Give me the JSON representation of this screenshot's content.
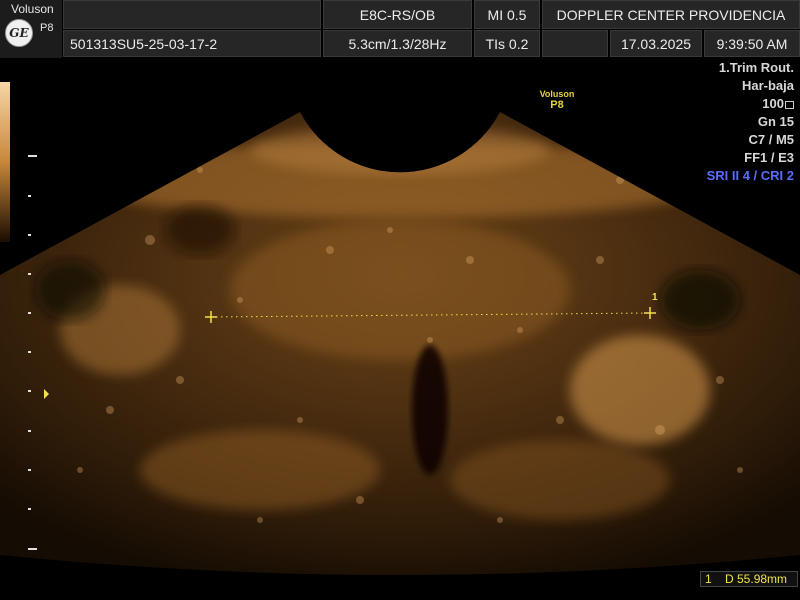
{
  "header": {
    "brand": "Voluson",
    "logo_text": "GE",
    "probe_small": "P8",
    "probe": "E8C-RS/OB",
    "mi": "MI  0.5",
    "center": "DOPPLER CENTER PROVIDENCIA",
    "patient_id": "501313SU5-25-03-17-2",
    "depth": "5.3cm/1.3/28Hz",
    "tis": "TIs  0.2",
    "date": "17.03.2025",
    "time": "9:39:50 AM"
  },
  "right_panel": {
    "preset": "1.Trim Rout.",
    "harmonic": "Har-baja",
    "power": "100",
    "gain": "Gn  15",
    "compression": "C7 / M5",
    "filter": "FF1 / E3",
    "sri": "SRI II 4 / CRI 2"
  },
  "image_label": {
    "brand": "Voluson",
    "probe": "P8"
  },
  "caliper": {
    "label": "1"
  },
  "measurement": {
    "text": "1    D 55.98mm"
  },
  "colors": {
    "tint": "#c8873a",
    "accent_yellow": "#f2e24a",
    "sri_blue": "#5a6cff"
  }
}
